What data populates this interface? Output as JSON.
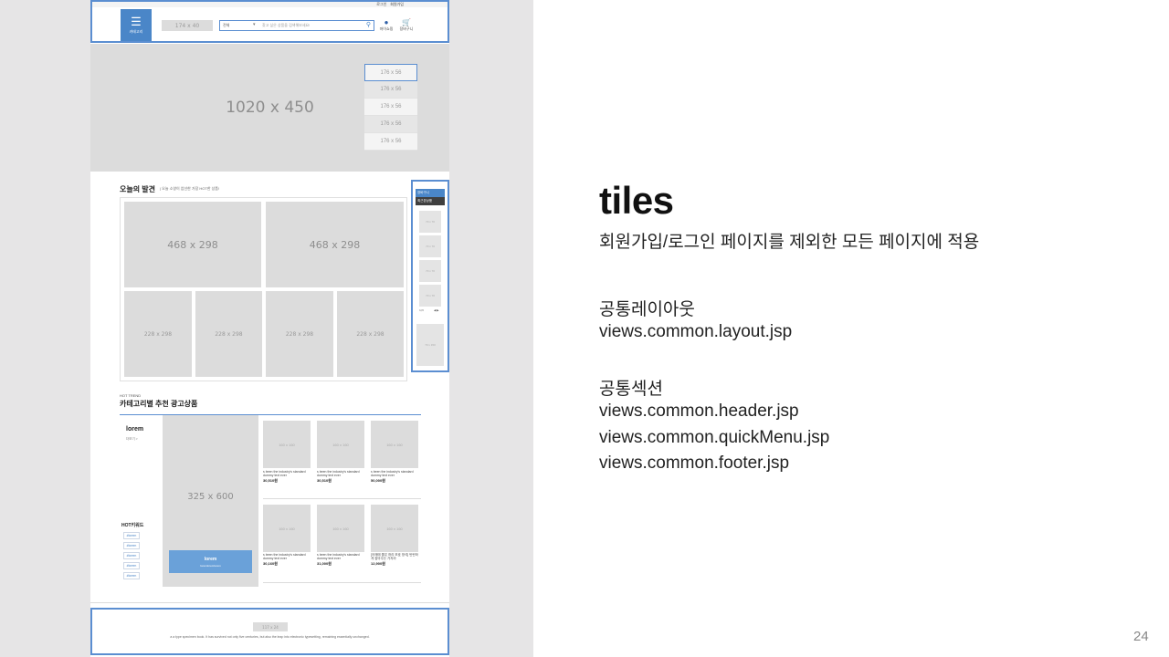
{
  "slide": {
    "title": "tiles",
    "subtitle": "회원가입/로그인 페이지를 제외한 모든 페이지에 적용",
    "layout_heading": "공통레이아웃",
    "layout_file": "views.common.layout.jsp",
    "section_heading": "공통섹션",
    "section_files": [
      "views.common.header.jsp",
      "views.common.quickMenu.jsp",
      "views.common.footer.jsp"
    ],
    "page_number": "24"
  },
  "wireframe": {
    "header": {
      "top_links": [
        "로그인",
        "회원가입"
      ],
      "menu_icon": "hamburger-icon",
      "menu_label": "카테고리",
      "logo_placeholder": "174 x 40",
      "search_select": "전체",
      "search_placeholder": "찾고 싶은 상품을 검색해보세요!",
      "search_icon": "search-icon",
      "mypage_label": "마이쇼핑",
      "cart_label": "장바구니"
    },
    "banner": {
      "size": "1020 x 450",
      "side_items": [
        "176 x 56",
        "176 x 56",
        "176 x 56",
        "176 x 56",
        "176 x 56"
      ]
    },
    "today": {
      "title": "오늘의 발견",
      "subtitle": "| 오늘 소영이 엄선한 가장 HOT한 상품!",
      "big": [
        "468 x 298",
        "468 x 298"
      ],
      "small": [
        "228 x 298",
        "228 x 298",
        "228 x 298",
        "228 x 298"
      ]
    },
    "quick_menu": {
      "top_label": "장바구니",
      "recent_label": "최근본상품",
      "thumb_label": "70 x 70",
      "pager_left": "1/3",
      "pager_right": "◀ ▶",
      "ad_label": "70 x 150"
    },
    "hot_trend": {
      "label": "HOT TREND",
      "title": "카테고리별 추천 광고상품",
      "lorem_title": "lorem",
      "lorem_more": "더보기 >",
      "keywords_title": "HOT키워드",
      "keywords": [
        "#lorem",
        "#lorem",
        "#lorem",
        "#lorem",
        "#lorem"
      ],
      "tall_ad": "325 x 600",
      "tall_btn_title": "lorem",
      "tall_btn_sub": "loremloremlorem",
      "product_size": "160 x 160",
      "products": [
        {
          "desc": "s been the industry's standard dummy text ever",
          "price": "30,510원"
        },
        {
          "desc": "s been the industry's standard dummy text ever",
          "price": "30,510원"
        },
        {
          "desc": "s been the industry's standard dummy text ever",
          "price": "50,000원"
        },
        {
          "desc": "s been the industry's standard dummy text ever",
          "price": "30,160원"
        },
        {
          "desc": "s been the industry's standard dummy text ever",
          "price": "31,000원"
        },
        {
          "desc": "[어깨에 좋은 허리 보호 방석] 탄탄하게 잡아주는 가지라",
          "price": "12,900원"
        }
      ]
    },
    "footer": {
      "logo_placeholder": "117 x 24",
      "text": "a a type specimen book. It has survived not only five centuries, but also the leap into electronic typesetting, remaining essentially unchanged."
    }
  }
}
